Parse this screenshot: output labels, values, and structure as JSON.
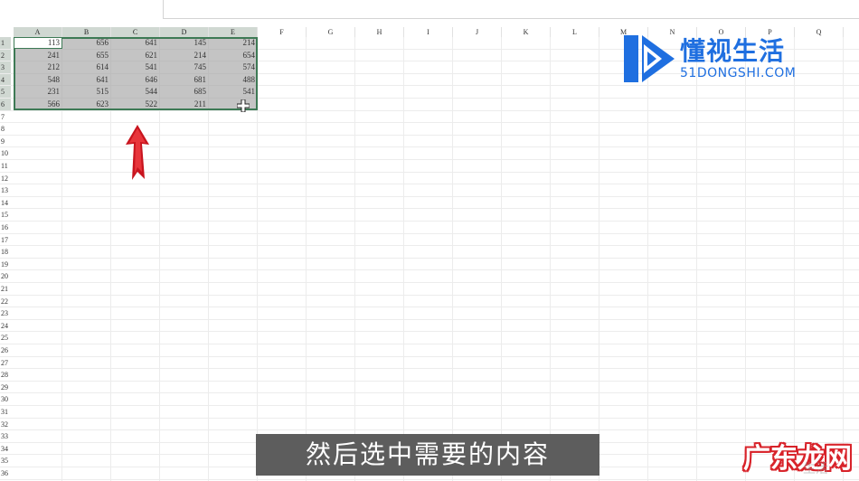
{
  "columns": [
    "A",
    "B",
    "C",
    "D",
    "E",
    "F",
    "G",
    "H",
    "I",
    "J",
    "K",
    "L",
    "M",
    "N",
    "O",
    "P",
    "Q"
  ],
  "rows": [
    "1",
    "2",
    "3",
    "4",
    "5",
    "6",
    "7",
    "8",
    "9",
    "10",
    "11",
    "12",
    "13",
    "14",
    "15",
    "16",
    "17",
    "18",
    "19",
    "20",
    "21",
    "22",
    "23",
    "24",
    "25",
    "26",
    "27",
    "28",
    "29",
    "30",
    "31",
    "32",
    "33",
    "34",
    "35",
    "36"
  ],
  "cells": [
    [
      "113",
      "656",
      "641",
      "145",
      "214"
    ],
    [
      "241",
      "655",
      "621",
      "214",
      "654"
    ],
    [
      "212",
      "614",
      "541",
      "745",
      "574"
    ],
    [
      "548",
      "641",
      "646",
      "681",
      "488"
    ],
    [
      "231",
      "515",
      "544",
      "685",
      "541"
    ],
    [
      "566",
      "623",
      "522",
      "211",
      ""
    ]
  ],
  "logo": {
    "brand": "懂视生活",
    "domain": "51DONGSHI.COM"
  },
  "subtitle": "然后选中需要的内容",
  "watermark": {
    "text": "广东龙网",
    "faint": "生活"
  },
  "colors": {
    "selection_border": "#3d7a55",
    "logo_blue": "#1f6fe0",
    "arrow_red": "#c8141e",
    "watermark_red": "#d8232a"
  }
}
